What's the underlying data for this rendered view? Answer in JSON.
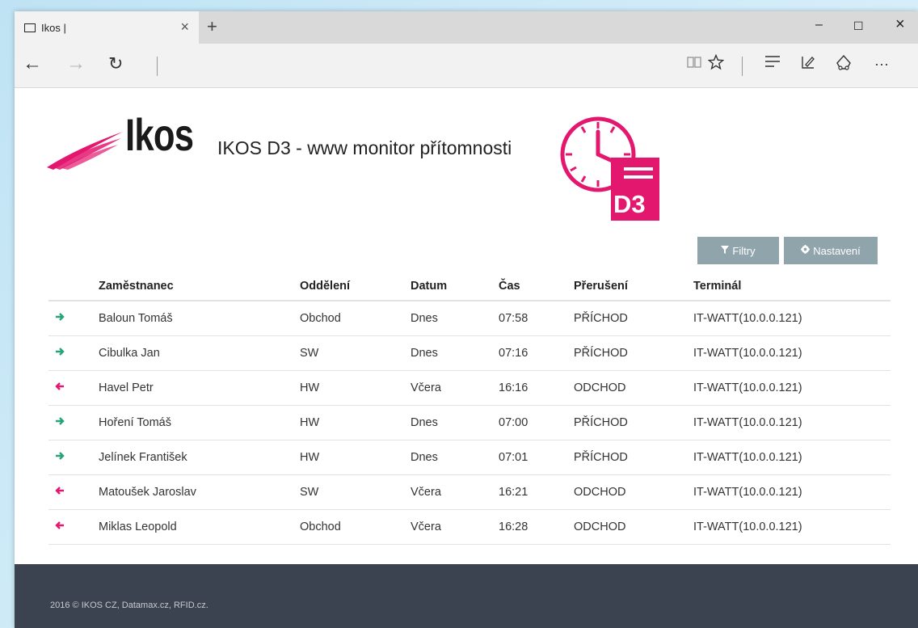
{
  "browser": {
    "tab_title": "Ikos |",
    "tab_close": "×",
    "new_tab": "+",
    "window_controls": {
      "minimize": "–",
      "maximize": "☐",
      "close": "×"
    },
    "nav": {
      "back": "←",
      "forward": "→",
      "refresh": "↻"
    },
    "toolbar_icons": [
      "reading-view-icon",
      "favorite-star-icon",
      "hub-icon",
      "web-note-icon",
      "share-icon",
      "more-icon"
    ],
    "more": "···"
  },
  "header": {
    "logo_text": "Ikos",
    "app_title": "IKOS D3 - www monitor přítomnosti",
    "d3_badge": "D3",
    "brand_color": "#e4176e"
  },
  "actions": {
    "filter_label": "Filtry",
    "settings_label": "Nastavení"
  },
  "table": {
    "columns": [
      "Zaměstnanec",
      "Oddělení",
      "Datum",
      "Čas",
      "Přerušení",
      "Terminál"
    ],
    "rows": [
      {
        "dir": "in",
        "name": "Baloun Tomáš",
        "dept": "Obchod",
        "date": "Dnes",
        "time": "07:58",
        "status": "PŘÍCHOD",
        "terminal": "IT-WATT(10.0.0.121)"
      },
      {
        "dir": "in",
        "name": "Cibulka Jan",
        "dept": "SW",
        "date": "Dnes",
        "time": "07:16",
        "status": "PŘÍCHOD",
        "terminal": "IT-WATT(10.0.0.121)"
      },
      {
        "dir": "out",
        "name": "Havel Petr",
        "dept": "HW",
        "date": "Včera",
        "time": "16:16",
        "status": "ODCHOD",
        "terminal": "IT-WATT(10.0.0.121)"
      },
      {
        "dir": "in",
        "name": "Hoření Tomáš",
        "dept": "HW",
        "date": "Dnes",
        "time": "07:00",
        "status": "PŘÍCHOD",
        "terminal": "IT-WATT(10.0.0.121)"
      },
      {
        "dir": "in",
        "name": "Jelínek František",
        "dept": "HW",
        "date": "Dnes",
        "time": "07:01",
        "status": "PŘÍCHOD",
        "terminal": "IT-WATT(10.0.0.121)"
      },
      {
        "dir": "out",
        "name": "Matoušek Jaroslav",
        "dept": "SW",
        "date": "Včera",
        "time": "16:21",
        "status": "ODCHOD",
        "terminal": "IT-WATT(10.0.0.121)"
      },
      {
        "dir": "out",
        "name": "Miklas Leopold",
        "dept": "Obchod",
        "date": "Včera",
        "time": "16:28",
        "status": "ODCHOD",
        "terminal": "IT-WATT(10.0.0.121)"
      }
    ],
    "arrow_in": "➔",
    "arrow_out": "🡐",
    "in_color": "#27a37a",
    "out_color": "#e4176e"
  },
  "footer": {
    "text": "2016 © IKOS CZ, Datamax.cz, RFID.cz."
  }
}
